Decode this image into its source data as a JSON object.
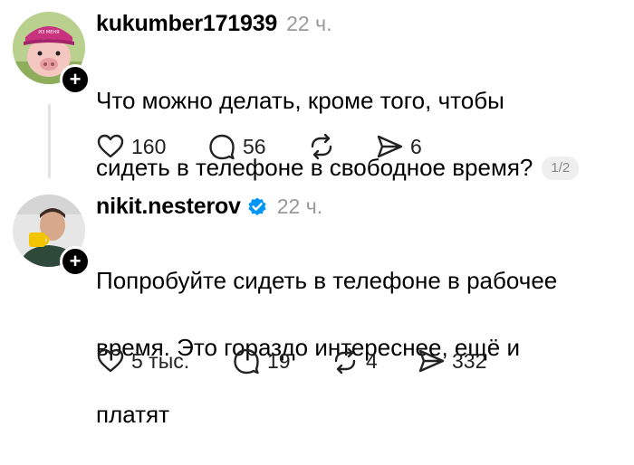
{
  "posts": [
    {
      "username": "kukumber171939",
      "time": "22 ч.",
      "text_line1": "Что можно делать, кроме того, чтобы",
      "text_line2": "сидеть в телефоне в свободное время?",
      "pager": "1/2",
      "avatar_icon": "pig-avatar",
      "actions": {
        "likes": "160",
        "comments": "56",
        "reposts": "",
        "shares": "6"
      }
    },
    {
      "username": "nikit.nesterov",
      "verified": true,
      "time": "22 ч.",
      "text_line1": "Попробуйте сидеть в телефоне в рабочее",
      "text_line2": "время. Это гораздо интереснее, ещё и",
      "text_line3": "платят",
      "avatar_icon": "man-with-cup-avatar",
      "actions": {
        "likes": "5 тыс.",
        "comments": "19",
        "reposts": "4",
        "shares": "332"
      }
    }
  ],
  "colors": {
    "text": "#000000",
    "meta": "#999999",
    "verified": "#0095f6",
    "thread_line": "#e3e3e3"
  }
}
